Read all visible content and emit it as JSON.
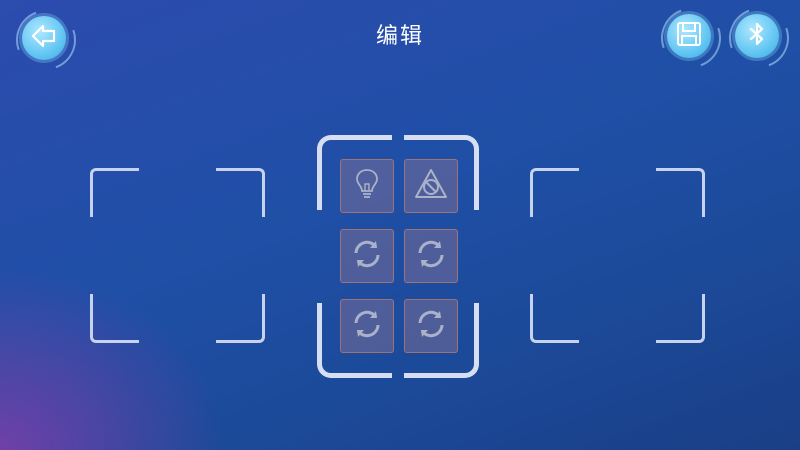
{
  "header": {
    "title": "编辑",
    "back_icon": "arrow-left-icon",
    "save_icon": "floppy-disk-icon",
    "bluetooth_icon": "bluetooth-icon"
  },
  "colors": {
    "button_fill": "#63c6f3",
    "frame_stroke": "#c7d2ee",
    "tile_fill": "#7a6e96",
    "tile_border": "#b4786e"
  },
  "slots": [
    {
      "name": "left-slot",
      "state": "empty"
    },
    {
      "name": "center-slot",
      "state": "selected"
    },
    {
      "name": "right-slot",
      "state": "empty"
    }
  ],
  "tiles": [
    {
      "icon": "lightbulb-icon"
    },
    {
      "icon": "no-obstacle-icon"
    },
    {
      "icon": "rotate-icon"
    },
    {
      "icon": "rotate-icon"
    },
    {
      "icon": "rotate-icon"
    },
    {
      "icon": "rotate-icon"
    }
  ]
}
